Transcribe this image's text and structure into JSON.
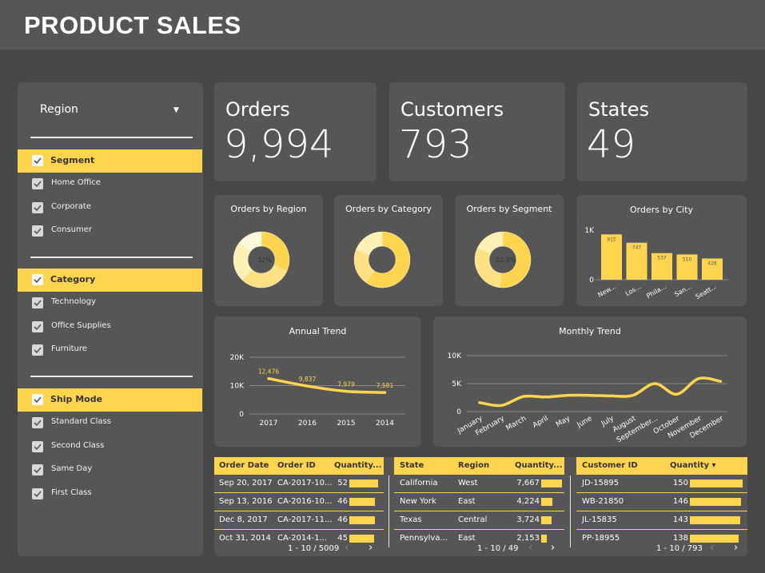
{
  "title": "PRODUCT SALES",
  "sidebar": {
    "region_label": "Region",
    "groups": [
      {
        "label": "Segment",
        "options": [
          "Home Office",
          "Corporate",
          "Consumer"
        ]
      },
      {
        "label": "Category",
        "options": [
          "Technology",
          "Office Supplies",
          "Furniture"
        ]
      },
      {
        "label": "Ship Mode",
        "options": [
          "Standard Class",
          "Second Class",
          "Same Day",
          "First Class"
        ]
      }
    ]
  },
  "kpis": [
    {
      "label": "Orders",
      "value": "9,994"
    },
    {
      "label": "Customers",
      "value": "793"
    },
    {
      "label": "States",
      "value": "49"
    }
  ],
  "donuts": [
    {
      "title": "Orders by Region",
      "label": "32%"
    },
    {
      "title": "Orders by Category",
      "label": ""
    },
    {
      "title": "Orders by Segment",
      "label": "51.9%"
    }
  ],
  "colors": {
    "accent": "#ffd54f",
    "panel": "#565656",
    "background": "#474747",
    "donut_shades": [
      "#ffd54f",
      "#ffe082",
      "#fff0b3",
      "#fff8dc"
    ]
  },
  "chart_data": [
    {
      "type": "pie",
      "title": "Orders by Region",
      "values": [
        32,
        30,
        23,
        15
      ],
      "labels": [
        "32%"
      ],
      "donut": true
    },
    {
      "type": "pie",
      "title": "Orders by Category",
      "values": [
        60,
        21,
        19
      ],
      "donut": true
    },
    {
      "type": "pie",
      "title": "Orders by Segment",
      "values": [
        51.9,
        30.2,
        17.9
      ],
      "labels": [
        "51.9%"
      ],
      "donut": true
    },
    {
      "type": "bar",
      "title": "Orders by City",
      "categories": [
        "New...",
        "Los...",
        "Phila...",
        "San...",
        "Seatt..."
      ],
      "values": [
        915,
        747,
        537,
        510,
        428
      ],
      "value_labels": [
        "915",
        "747",
        "537",
        "510",
        "428"
      ],
      "yticks": [
        "0",
        "1K"
      ],
      "ylim": [
        0,
        1000
      ]
    },
    {
      "type": "line",
      "title": "Annual Trend",
      "categories": [
        "2017",
        "2016",
        "2015",
        "2014"
      ],
      "values": [
        12476,
        9837,
        7979,
        7581
      ],
      "value_labels": [
        "12,476",
        "9,837",
        "7,979",
        "7,581"
      ],
      "yticks": [
        "0",
        "10K",
        "20K"
      ],
      "ylim": [
        0,
        20000
      ],
      "grid": true
    },
    {
      "type": "line",
      "title": "Monthly Trend",
      "categories": [
        "January",
        "February",
        "March",
        "April",
        "May",
        "June",
        "July",
        "August",
        "September...",
        "October",
        "November",
        "December"
      ],
      "values": [
        1600,
        1100,
        2700,
        2600,
        2900,
        2900,
        2800,
        2900,
        5000,
        3100,
        5900,
        5400
      ],
      "yticks": [
        "0",
        "5K",
        "10K"
      ],
      "ylim": [
        0,
        10000
      ],
      "grid": true
    }
  ],
  "tables": [
    {
      "headers": [
        "Order Date",
        "Order ID",
        "Quantity..."
      ],
      "rows": [
        {
          "c1": "Sep 20, 2017",
          "c2": "CA-2017-10...",
          "val": "52",
          "n": 52
        },
        {
          "c1": "Sep 13, 2016",
          "c2": "CA-2016-10...",
          "val": "46",
          "n": 46
        },
        {
          "c1": "Dec 8, 2017",
          "c2": "CA-2017-11...",
          "val": "46",
          "n": 46
        },
        {
          "c1": "Oct 31, 2014",
          "c2": "CA-2014-1...",
          "val": "45",
          "n": 45
        }
      ],
      "pager": "1 - 10 / 5009"
    },
    {
      "headers": [
        "State",
        "Region",
        "Quantity..."
      ],
      "rows": [
        {
          "c1": "California",
          "c2": "West",
          "val": "7,667",
          "n": 7667
        },
        {
          "c1": "New York",
          "c2": "East",
          "val": "4,224",
          "n": 4224
        },
        {
          "c1": "Texas",
          "c2": "Central",
          "val": "3,724",
          "n": 3724
        },
        {
          "c1": "Pennsylva...",
          "c2": "East",
          "val": "2,153",
          "n": 2153
        }
      ],
      "pager": "1 - 10 / 49"
    },
    {
      "headers": [
        "Customer ID",
        "Quantity ▾"
      ],
      "rows": [
        {
          "c1": "JD-15895",
          "val": "150",
          "n": 150
        },
        {
          "c1": "WB-21850",
          "val": "146",
          "n": 146
        },
        {
          "c1": "JL-15835",
          "val": "143",
          "n": 143
        },
        {
          "c1": "PP-18955",
          "val": "138",
          "n": 138
        }
      ],
      "pager": "1 - 10 / 793"
    }
  ],
  "icons": {
    "dropdown": "caret-down-icon",
    "prev": "chevron-left-icon",
    "next": "chevron-right-icon",
    "check": "check-icon"
  }
}
